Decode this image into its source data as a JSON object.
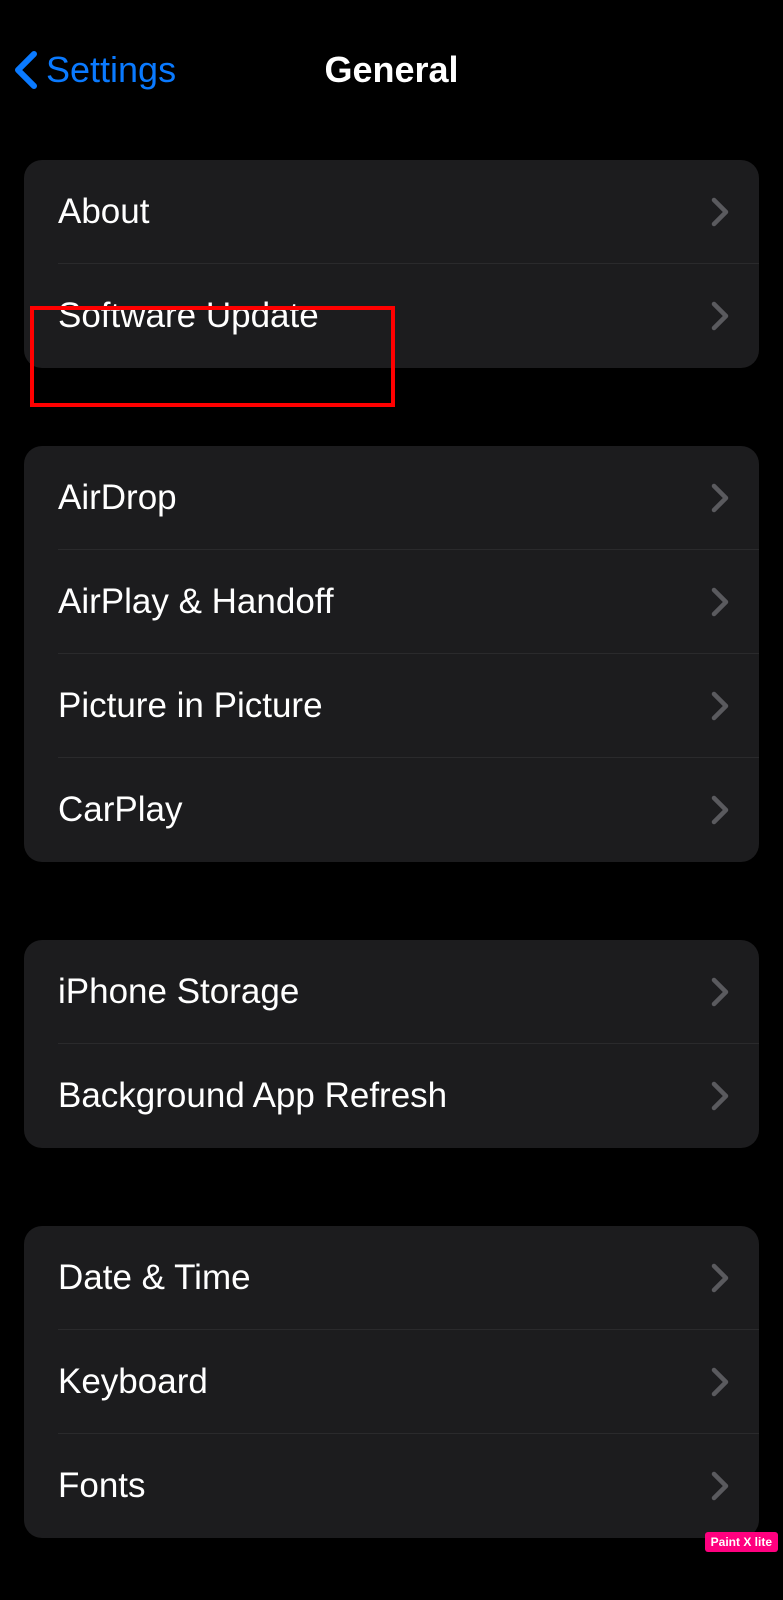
{
  "nav": {
    "back_label": "Settings",
    "title": "General"
  },
  "groups": [
    {
      "rows": [
        {
          "id": "about",
          "label": "About"
        },
        {
          "id": "software-update",
          "label": "Software Update"
        }
      ]
    },
    {
      "rows": [
        {
          "id": "airdrop",
          "label": "AirDrop"
        },
        {
          "id": "airplay-handoff",
          "label": "AirPlay & Handoff"
        },
        {
          "id": "picture-in-picture",
          "label": "Picture in Picture"
        },
        {
          "id": "carplay",
          "label": "CarPlay"
        }
      ]
    },
    {
      "rows": [
        {
          "id": "iphone-storage",
          "label": "iPhone Storage"
        },
        {
          "id": "background-app-refresh",
          "label": "Background App Refresh"
        }
      ]
    },
    {
      "rows": [
        {
          "id": "date-time",
          "label": "Date & Time"
        },
        {
          "id": "keyboard",
          "label": "Keyboard"
        },
        {
          "id": "fonts",
          "label": "Fonts"
        }
      ]
    }
  ],
  "watermark": "Paint X lite",
  "colors": {
    "link": "#0a7aff",
    "background": "#000000",
    "cell": "#1c1c1e",
    "highlight": "#ff0000"
  }
}
